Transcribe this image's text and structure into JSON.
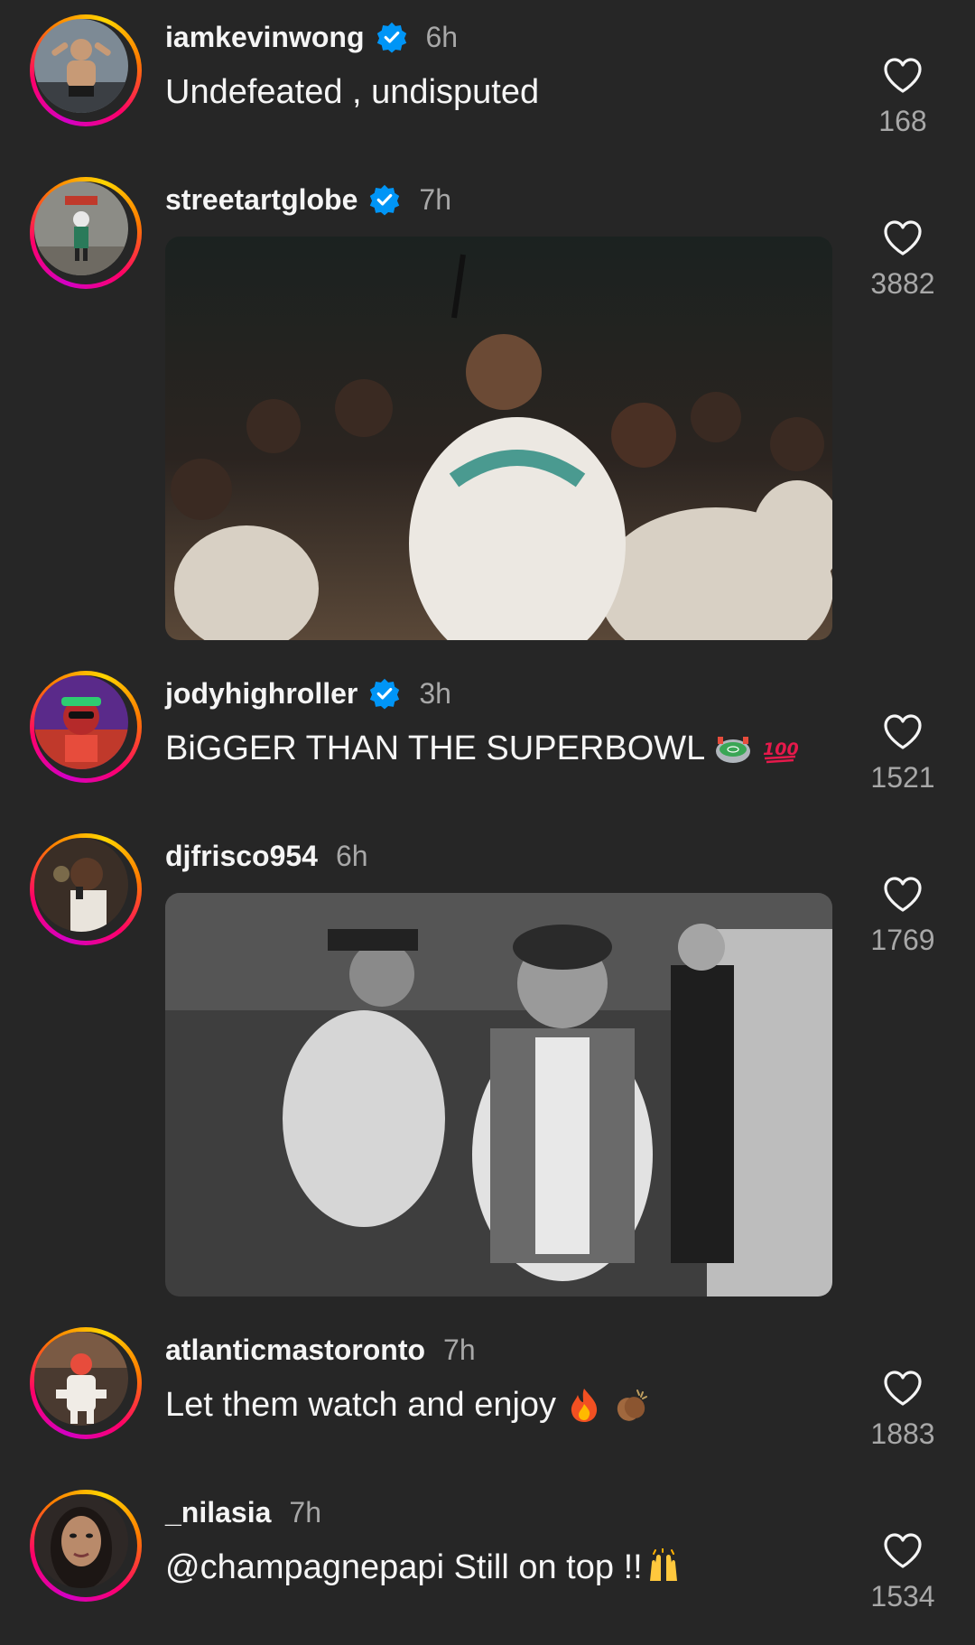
{
  "comments": [
    {
      "username": "iamkevinwong",
      "verified": true,
      "time": "6h",
      "text": "Undefeated , undisputed",
      "likes": "168"
    },
    {
      "username": "streetartglobe",
      "verified": true,
      "time": "7h",
      "media": "gif",
      "likes": "3882"
    },
    {
      "username": "jodyhighroller",
      "verified": true,
      "time": "3h",
      "text": "BiGGER THAN THE SUPERBOWL",
      "emojis": [
        "stadium-emoji",
        "hundred-points-emoji"
      ],
      "likes": "1521"
    },
    {
      "username": "djfrisco954",
      "verified": false,
      "time": "6h",
      "media": "gif",
      "likes": "1769"
    },
    {
      "username": "atlanticmastoronto",
      "verified": false,
      "time": "7h",
      "text": "Let them watch and enjoy",
      "emojis": [
        "fire-emoji",
        "clapping-hands-emoji"
      ],
      "likes": "1883"
    },
    {
      "username": "_nilasia",
      "verified": false,
      "time": "7h",
      "text": "@champagnepapi Still on top !!",
      "emojis": [
        "raising-hands-emoji"
      ],
      "likes": "1534"
    }
  ],
  "colors": {
    "background": "#262626",
    "text": "#f5f5f5",
    "secondary": "#a8a8a8",
    "verified": "#0095f6"
  }
}
